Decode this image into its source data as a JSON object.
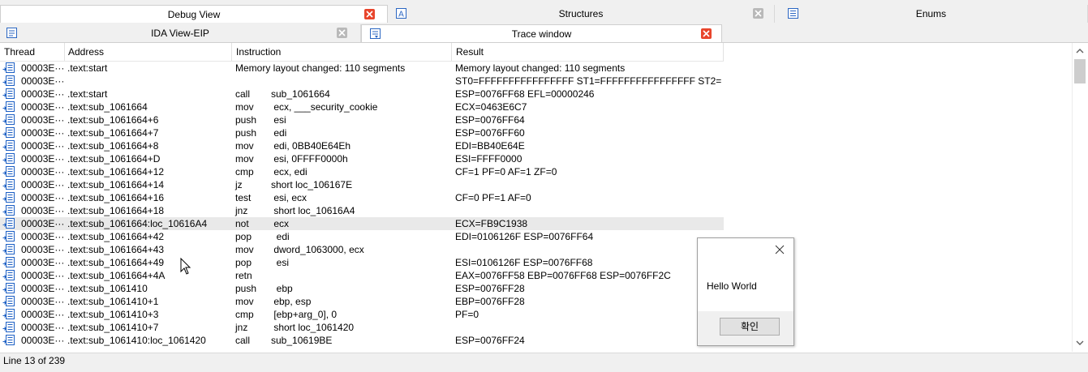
{
  "tabs_row1": [
    {
      "label": "Debug View",
      "close": "red-close-icon"
    },
    {
      "label": "Structures",
      "close": "gray-close-icon"
    },
    {
      "label": "Enums"
    }
  ],
  "tabs_row2": [
    {
      "label": "IDA View-EIP",
      "close": "gray-close-icon"
    },
    {
      "label": "Trace window",
      "close": "red-close-icon"
    }
  ],
  "columns": [
    "Thread",
    "Address",
    "Instruction",
    "Result"
  ],
  "rows": [
    {
      "thread": "00003E···",
      "address": ".text:start",
      "mnemonic": "Memory layout changed: 110 segments",
      "operand": "",
      "result": "Memory layout changed: 110 segments"
    },
    {
      "thread": "00003E···",
      "address": "",
      "mnemonic": "",
      "operand": "",
      "result": "ST0=FFFFFFFFFFFFFFFF ST1=FFFFFFFFFFFFFFFF ST2=···"
    },
    {
      "thread": "00003E···",
      "address": ".text:start",
      "mnemonic": "call",
      "operand": "sub_1061664",
      "result": "ESP=0076FF68 EFL=00000246"
    },
    {
      "thread": "00003E···",
      "address": ".text:sub_1061664",
      "mnemonic": "mov",
      "operand": " ecx, ___security_cookie",
      "result": "ECX=0463E6C7"
    },
    {
      "thread": "00003E···",
      "address": ".text:sub_1061664+6",
      "mnemonic": "push",
      "operand": " esi",
      "result": "ESP=0076FF64"
    },
    {
      "thread": "00003E···",
      "address": ".text:sub_1061664+7",
      "mnemonic": "push",
      "operand": " edi",
      "result": "ESP=0076FF60"
    },
    {
      "thread": "00003E···",
      "address": ".text:sub_1061664+8",
      "mnemonic": "mov",
      "operand": " edi, 0BB40E64Eh",
      "result": "EDI=BB40E64E"
    },
    {
      "thread": "00003E···",
      "address": ".text:sub_1061664+D",
      "mnemonic": "mov",
      "operand": " esi, 0FFFF0000h",
      "result": "ESI=FFFF0000"
    },
    {
      "thread": "00003E···",
      "address": ".text:sub_1061664+12",
      "mnemonic": "cmp",
      "operand": " ecx, edi",
      "result": "CF=1 PF=0 AF=1 ZF=0"
    },
    {
      "thread": "00003E···",
      "address": ".text:sub_1061664+14",
      "mnemonic": "jz",
      "operand": "short loc_106167E",
      "result": ""
    },
    {
      "thread": "00003E···",
      "address": ".text:sub_1061664+16",
      "mnemonic": "test",
      "operand": " esi, ecx",
      "result": "CF=0 PF=1 AF=0"
    },
    {
      "thread": "00003E···",
      "address": ".text:sub_1061664+18",
      "mnemonic": "jnz",
      "operand": " short loc_10616A4",
      "result": ""
    },
    {
      "thread": "00003E···",
      "address": ".text:sub_1061664:loc_10616A4",
      "mnemonic": "not",
      "operand": " ecx",
      "result": "ECX=FB9C1938"
    },
    {
      "thread": "00003E···",
      "address": ".text:sub_1061664+42",
      "mnemonic": "pop",
      "operand": "  edi",
      "result": "EDI=0106126F ESP=0076FF64"
    },
    {
      "thread": "00003E···",
      "address": ".text:sub_1061664+43",
      "mnemonic": "mov",
      "operand": " dword_1063000, ecx",
      "result": ""
    },
    {
      "thread": "00003E···",
      "address": ".text:sub_1061664+49",
      "mnemonic": "pop",
      "operand": "  esi",
      "result": "ESI=0106126F ESP=0076FF68"
    },
    {
      "thread": "00003E···",
      "address": ".text:sub_1061664+4A",
      "mnemonic": "retn",
      "operand": "",
      "result": "EAX=0076FF58 EBP=0076FF68 ESP=0076FF2C"
    },
    {
      "thread": "00003E···",
      "address": ".text:sub_1061410",
      "mnemonic": "push",
      "operand": "  ebp",
      "result": "ESP=0076FF28"
    },
    {
      "thread": "00003E···",
      "address": ".text:sub_1061410+1",
      "mnemonic": "mov",
      "operand": " ebp, esp",
      "result": "EBP=0076FF28"
    },
    {
      "thread": "00003E···",
      "address": ".text:sub_1061410+3",
      "mnemonic": "cmp",
      "operand": " [ebp+arg_0], 0",
      "result": "PF=0"
    },
    {
      "thread": "00003E···",
      "address": ".text:sub_1061410+7",
      "mnemonic": "jnz",
      "operand": " short loc_1061420",
      "result": ""
    },
    {
      "thread": "00003E···",
      "address": ".text:sub_1061410:loc_1061420",
      "mnemonic": "call",
      "operand": "sub_10619BE",
      "result": "ESP=0076FF24"
    }
  ],
  "selected_row": 12,
  "status": "Line 13 of 239",
  "dialog": {
    "message": "Hello World",
    "ok_label": "확인"
  },
  "colors": {
    "close_red": "#e8452c",
    "close_gray": "#b9b9b9",
    "row_icon_blue": "#1c5fc4",
    "selection": "#e9e9e9"
  }
}
